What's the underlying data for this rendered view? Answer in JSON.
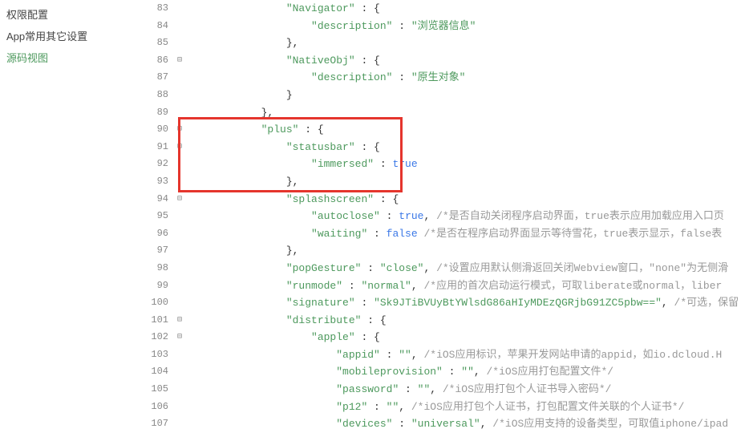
{
  "sidebar": {
    "items": [
      {
        "label": "权限配置"
      },
      {
        "label": "App常用其它设置"
      },
      {
        "label": "源码视图"
      }
    ],
    "activeIndex": 2
  },
  "code": {
    "lines": [
      {
        "n": 83,
        "fold": "",
        "indent": 4,
        "tokens": [
          [
            "s",
            "\"Navigator\""
          ],
          [
            "p",
            " : {"
          ]
        ]
      },
      {
        "n": 84,
        "fold": "",
        "indent": 5,
        "tokens": [
          [
            "s",
            "\"description\""
          ],
          [
            "p",
            " : "
          ],
          [
            "s",
            "\"浏览器信息\""
          ]
        ]
      },
      {
        "n": 85,
        "fold": "",
        "indent": 4,
        "tokens": [
          [
            "p",
            "},"
          ]
        ]
      },
      {
        "n": 86,
        "fold": "⊟",
        "indent": 4,
        "tokens": [
          [
            "s",
            "\"NativeObj\""
          ],
          [
            "p",
            " : {"
          ]
        ]
      },
      {
        "n": 87,
        "fold": "",
        "indent": 5,
        "tokens": [
          [
            "s",
            "\"description\""
          ],
          [
            "p",
            " : "
          ],
          [
            "s",
            "\"原生对象\""
          ]
        ]
      },
      {
        "n": 88,
        "fold": "",
        "indent": 4,
        "tokens": [
          [
            "p",
            "}"
          ]
        ]
      },
      {
        "n": 89,
        "fold": "",
        "indent": 3,
        "tokens": [
          [
            "p",
            "},"
          ]
        ]
      },
      {
        "n": 90,
        "fold": "⊟",
        "indent": 3,
        "tokens": [
          [
            "s",
            "\"plus\""
          ],
          [
            "p",
            " : {"
          ]
        ]
      },
      {
        "n": 91,
        "fold": "⊟",
        "indent": 4,
        "tokens": [
          [
            "s",
            "\"statusbar\""
          ],
          [
            "p",
            " : {"
          ]
        ]
      },
      {
        "n": 92,
        "fold": "",
        "indent": 5,
        "tokens": [
          [
            "s",
            "\"immersed\""
          ],
          [
            "p",
            " : "
          ],
          [
            "k",
            "true"
          ]
        ]
      },
      {
        "n": 93,
        "fold": "",
        "indent": 4,
        "tokens": [
          [
            "p",
            "},"
          ]
        ]
      },
      {
        "n": 94,
        "fold": "⊟",
        "indent": 4,
        "tokens": [
          [
            "s",
            "\"splashscreen\""
          ],
          [
            "p",
            " : {"
          ]
        ]
      },
      {
        "n": 95,
        "fold": "",
        "indent": 5,
        "tokens": [
          [
            "s",
            "\"autoclose\""
          ],
          [
            "p",
            " : "
          ],
          [
            "k",
            "true"
          ],
          [
            "p",
            ", "
          ],
          [
            "c",
            "/*是否自动关闭程序启动界面，true表示应用加载应用入口页"
          ]
        ]
      },
      {
        "n": 96,
        "fold": "",
        "indent": 5,
        "tokens": [
          [
            "s",
            "\"waiting\""
          ],
          [
            "p",
            " : "
          ],
          [
            "k",
            "false"
          ],
          [
            "p",
            " "
          ],
          [
            "c",
            "/*是否在程序启动界面显示等待雪花，true表示显示，false表"
          ]
        ]
      },
      {
        "n": 97,
        "fold": "",
        "indent": 4,
        "tokens": [
          [
            "p",
            "},"
          ]
        ]
      },
      {
        "n": 98,
        "fold": "",
        "indent": 4,
        "tokens": [
          [
            "s",
            "\"popGesture\""
          ],
          [
            "p",
            " : "
          ],
          [
            "s",
            "\"close\""
          ],
          [
            "p",
            ", "
          ],
          [
            "c",
            "/*设置应用默认侧滑返回关闭Webview窗口，\"none\"为无侧滑"
          ]
        ]
      },
      {
        "n": 99,
        "fold": "",
        "indent": 4,
        "tokens": [
          [
            "s",
            "\"runmode\""
          ],
          [
            "p",
            " : "
          ],
          [
            "s",
            "\"normal\""
          ],
          [
            "p",
            ", "
          ],
          [
            "c",
            "/*应用的首次启动运行模式，可取liberate或normal，liber"
          ]
        ]
      },
      {
        "n": 100,
        "fold": "",
        "indent": 4,
        "tokens": [
          [
            "s",
            "\"signature\""
          ],
          [
            "p",
            " : "
          ],
          [
            "s",
            "\"Sk9JTiBVUyBtYWlsdG86aHIyMDEzQGRjbG91ZC5pbw==\""
          ],
          [
            "p",
            ", "
          ],
          [
            "c",
            "/*可选，保留"
          ]
        ]
      },
      {
        "n": 101,
        "fold": "⊟",
        "indent": 4,
        "tokens": [
          [
            "s",
            "\"distribute\""
          ],
          [
            "p",
            " : {"
          ]
        ]
      },
      {
        "n": 102,
        "fold": "⊟",
        "indent": 5,
        "tokens": [
          [
            "s",
            "\"apple\""
          ],
          [
            "p",
            " : {"
          ]
        ]
      },
      {
        "n": 103,
        "fold": "",
        "indent": 6,
        "tokens": [
          [
            "s",
            "\"appid\""
          ],
          [
            "p",
            " : "
          ],
          [
            "s",
            "\"\""
          ],
          [
            "p",
            ", "
          ],
          [
            "c",
            "/*iOS应用标识，苹果开发网站申请的appid，如io.dcloud.H"
          ]
        ]
      },
      {
        "n": 104,
        "fold": "",
        "indent": 6,
        "tokens": [
          [
            "s",
            "\"mobileprovision\""
          ],
          [
            "p",
            " : "
          ],
          [
            "s",
            "\"\""
          ],
          [
            "p",
            ", "
          ],
          [
            "c",
            "/*iOS应用打包配置文件*/"
          ]
        ]
      },
      {
        "n": 105,
        "fold": "",
        "indent": 6,
        "tokens": [
          [
            "s",
            "\"password\""
          ],
          [
            "p",
            " : "
          ],
          [
            "s",
            "\"\""
          ],
          [
            "p",
            ", "
          ],
          [
            "c",
            "/*iOS应用打包个人证书导入密码*/"
          ]
        ]
      },
      {
        "n": 106,
        "fold": "",
        "indent": 6,
        "tokens": [
          [
            "s",
            "\"p12\""
          ],
          [
            "p",
            " : "
          ],
          [
            "s",
            "\"\""
          ],
          [
            "p",
            ", "
          ],
          [
            "c",
            "/*iOS应用打包个人证书，打包配置文件关联的个人证书*/"
          ]
        ]
      },
      {
        "n": 107,
        "fold": "",
        "indent": 6,
        "tokens": [
          [
            "s",
            "\"devices\""
          ],
          [
            "p",
            " : "
          ],
          [
            "s",
            "\"universal\""
          ],
          [
            "p",
            ", "
          ],
          [
            "c",
            "/*iOS应用支持的设备类型，可取值iphone/ipad"
          ]
        ]
      }
    ]
  }
}
